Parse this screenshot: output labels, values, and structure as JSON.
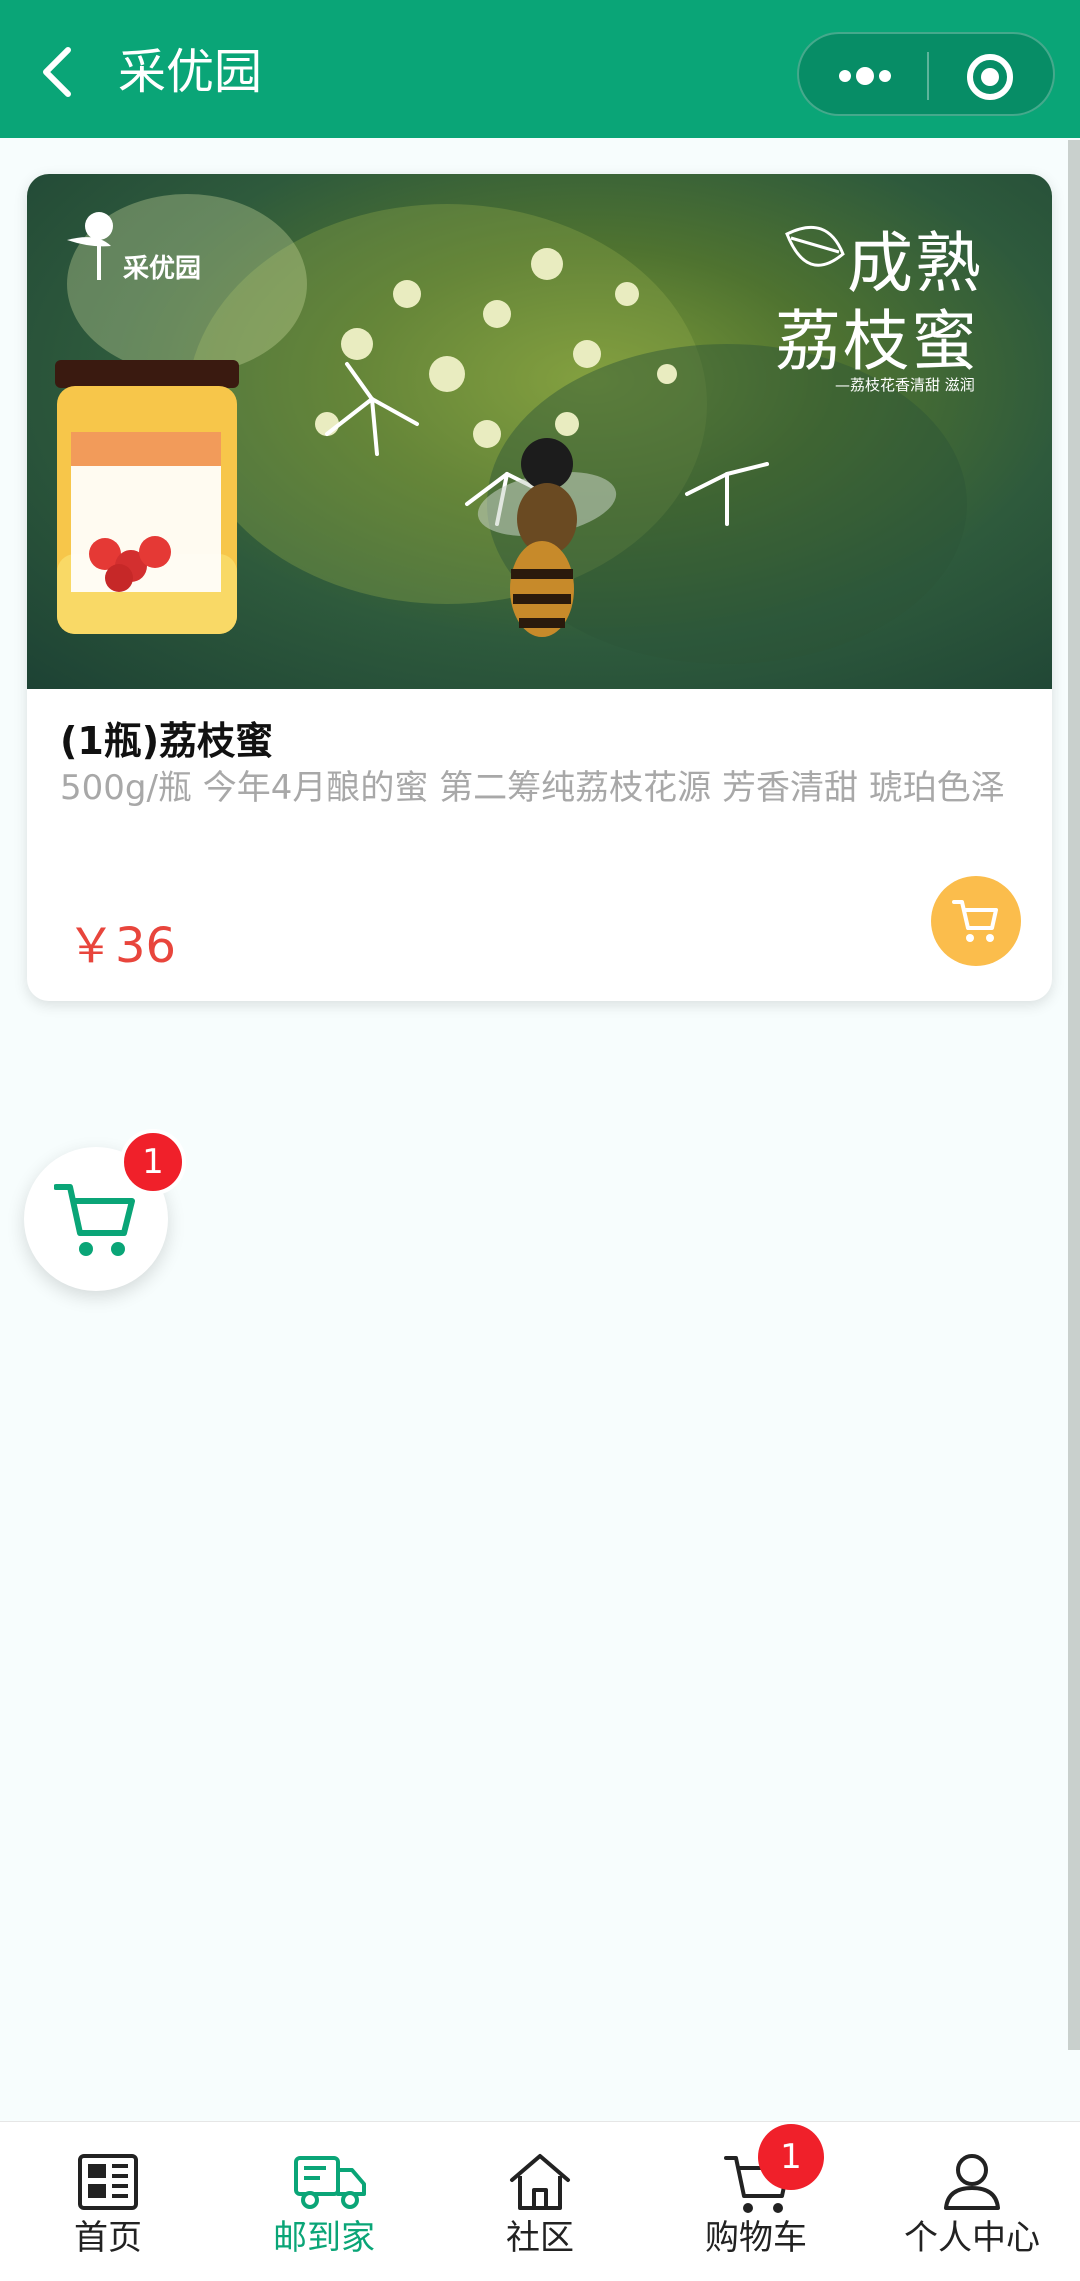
{
  "header": {
    "title": "采优园"
  },
  "product": {
    "banner": {
      "brand": "采优园",
      "headline_line1": "成熟",
      "headline_line2": "荔枝蜜",
      "tagline": "—荔枝花香清甜 滋润"
    },
    "name": "(1瓶)荔枝蜜",
    "description": "500g/瓶 今年4月酿的蜜 第二筹纯荔枝花源 芳香清甜 琥珀色泽",
    "price": "￥36"
  },
  "floating_cart": {
    "badge": "1"
  },
  "nav": {
    "items": [
      {
        "label": "首页",
        "icon": "news-icon"
      },
      {
        "label": "邮到家",
        "icon": "delivery-truck-icon"
      },
      {
        "label": "社区",
        "icon": "home-icon"
      },
      {
        "label": "购物车",
        "icon": "cart-icon"
      },
      {
        "label": "个人中心",
        "icon": "user-icon"
      }
    ],
    "cart_badge": "1"
  },
  "colors": {
    "primary": "#0aa577",
    "price": "#e8453c",
    "cart_button": "#fbbd4c",
    "badge": "#f0202a"
  }
}
